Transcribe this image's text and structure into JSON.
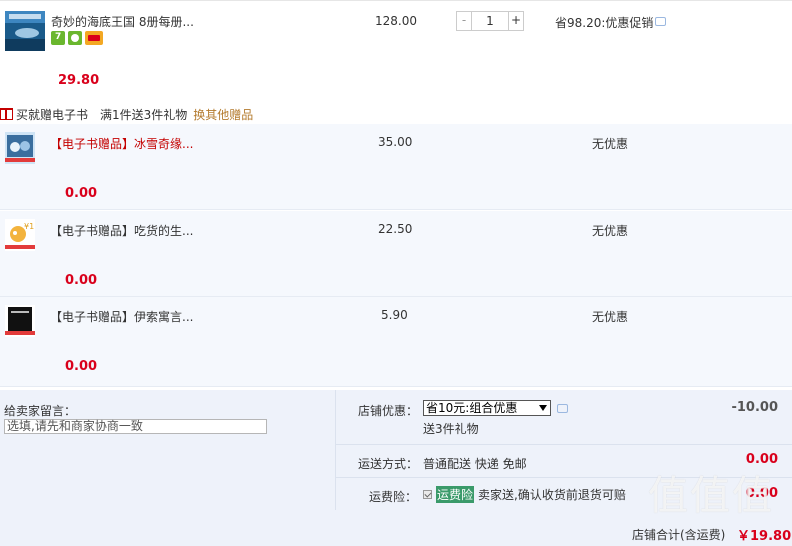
{
  "main_item": {
    "title": "奇妙的海底王国 8册每册...",
    "unit_price": "128.00",
    "quantity": "1",
    "qty_minus": "-",
    "qty_plus": "+",
    "promo": "省98.20:优惠促销",
    "subtotal": "29.80"
  },
  "gift_bar": {
    "label": "买就赠电子书",
    "rule": "满1件送3件礼物",
    "link": "换其他赠品"
  },
  "gifts": [
    {
      "tag": "【电子书赠品】",
      "title": "冰雪奇缘...",
      "unit_price": "35.00",
      "promo": "无优惠",
      "subtotal": "0.00"
    },
    {
      "tag": "【电子书赠品】",
      "title": "吃货的生...",
      "unit_price": "22.50",
      "promo": "无优惠",
      "subtotal": "0.00"
    },
    {
      "tag": "【电子书赠品】",
      "title": "伊索寓言...",
      "unit_price": "5.90",
      "promo": "无优惠",
      "subtotal": "0.00"
    }
  ],
  "footer": {
    "message_label": "给卖家留言：",
    "message_placeholder": "选填,请先和商家协商一致",
    "store_discount_label": "店铺优惠：",
    "store_discount_option": "省10元:组合优惠",
    "store_discount_note": "送3件礼物",
    "store_discount_value": "-10.00",
    "shipping_label": "运送方式：",
    "shipping_text": "普通配送 快递 免邮",
    "shipping_value": "0.00",
    "insurance_label": "运费险：",
    "insurance_tag": "运费险",
    "insurance_text": "卖家送,确认收货前退货可赔",
    "insurance_value": "0.00",
    "total_label": "店铺合计(含运费)",
    "total_value": "￥19.80"
  },
  "watermark": "值值值",
  "colors": {
    "price_red": "#d9001b",
    "gift_tag_red": "#c40000",
    "link_brown": "#b47b2e",
    "footer_bg": "#eef2fa"
  }
}
